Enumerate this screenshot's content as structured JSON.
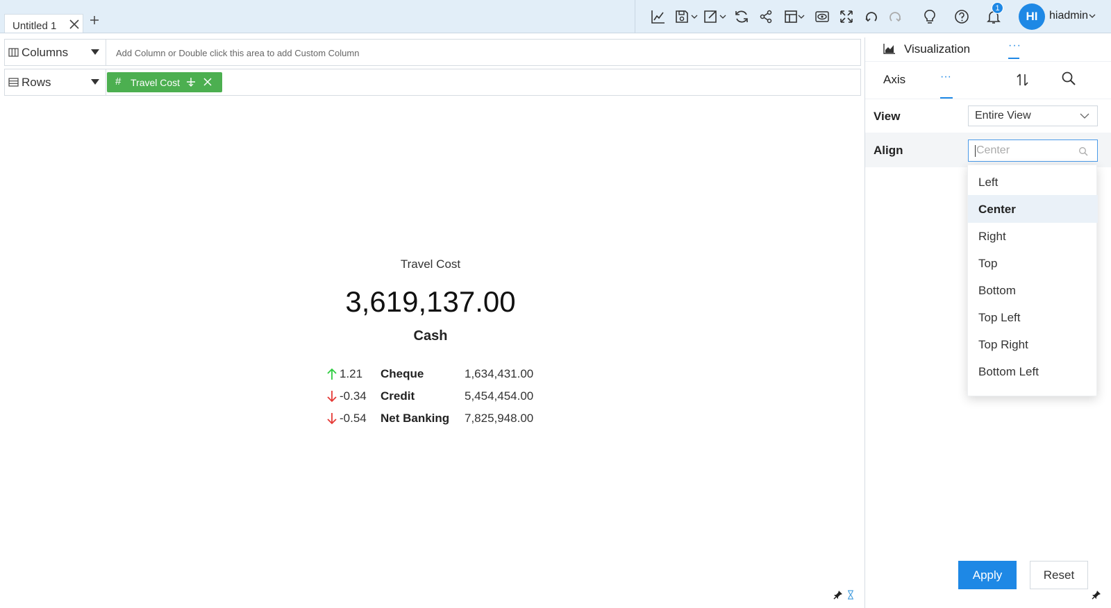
{
  "tabs": [
    {
      "label": "Untitled 1"
    }
  ],
  "user": {
    "initials": "HI",
    "name": "hiadmin",
    "notification_count": "1"
  },
  "toolbar": {
    "icons": [
      "chart-line-icon",
      "save-icon",
      "export-icon",
      "refresh-icon",
      "share-icon",
      "layout-icon",
      "preview-icon",
      "fullscreen-icon",
      "undo-icon",
      "redo-icon",
      "lightbulb-icon",
      "help-icon",
      "bell-icon"
    ]
  },
  "shelves": {
    "columns": {
      "label": "Columns",
      "placeholder": "Add Column or Double click this area to add Custom Column"
    },
    "rows": {
      "label": "Rows",
      "pill": {
        "type_symbol": "#",
        "label": "Travel Cost"
      }
    }
  },
  "card": {
    "title": "Travel Cost",
    "value": "3,619,137.00",
    "subtitle": "Cash",
    "comparisons": [
      {
        "direction": "up",
        "change": "1.21",
        "name": "Cheque",
        "value": "1,634,431.00"
      },
      {
        "direction": "down",
        "change": "-0.34",
        "name": "Credit",
        "value": "5,454,454.00"
      },
      {
        "direction": "down",
        "change": "-0.54",
        "name": "Net Banking",
        "value": "7,825,948.00"
      }
    ]
  },
  "panel": {
    "visualization_label": "Visualization",
    "more_label": "···",
    "axis_label": "Axis",
    "axis_more_label": "···",
    "view": {
      "label": "View",
      "value": "Entire View"
    },
    "align": {
      "label": "Align",
      "placeholder": "Center",
      "options": [
        "Left",
        "Center",
        "Right",
        "Top",
        "Bottom",
        "Top Left",
        "Top Right",
        "Bottom Left"
      ],
      "selected": "Center"
    },
    "apply_label": "Apply",
    "reset_label": "Reset"
  },
  "colors": {
    "accent": "#1e88e5",
    "pill": "#4caf50",
    "up": "#2ecc40",
    "down": "#e53935",
    "topbar": "#e2eef8"
  }
}
